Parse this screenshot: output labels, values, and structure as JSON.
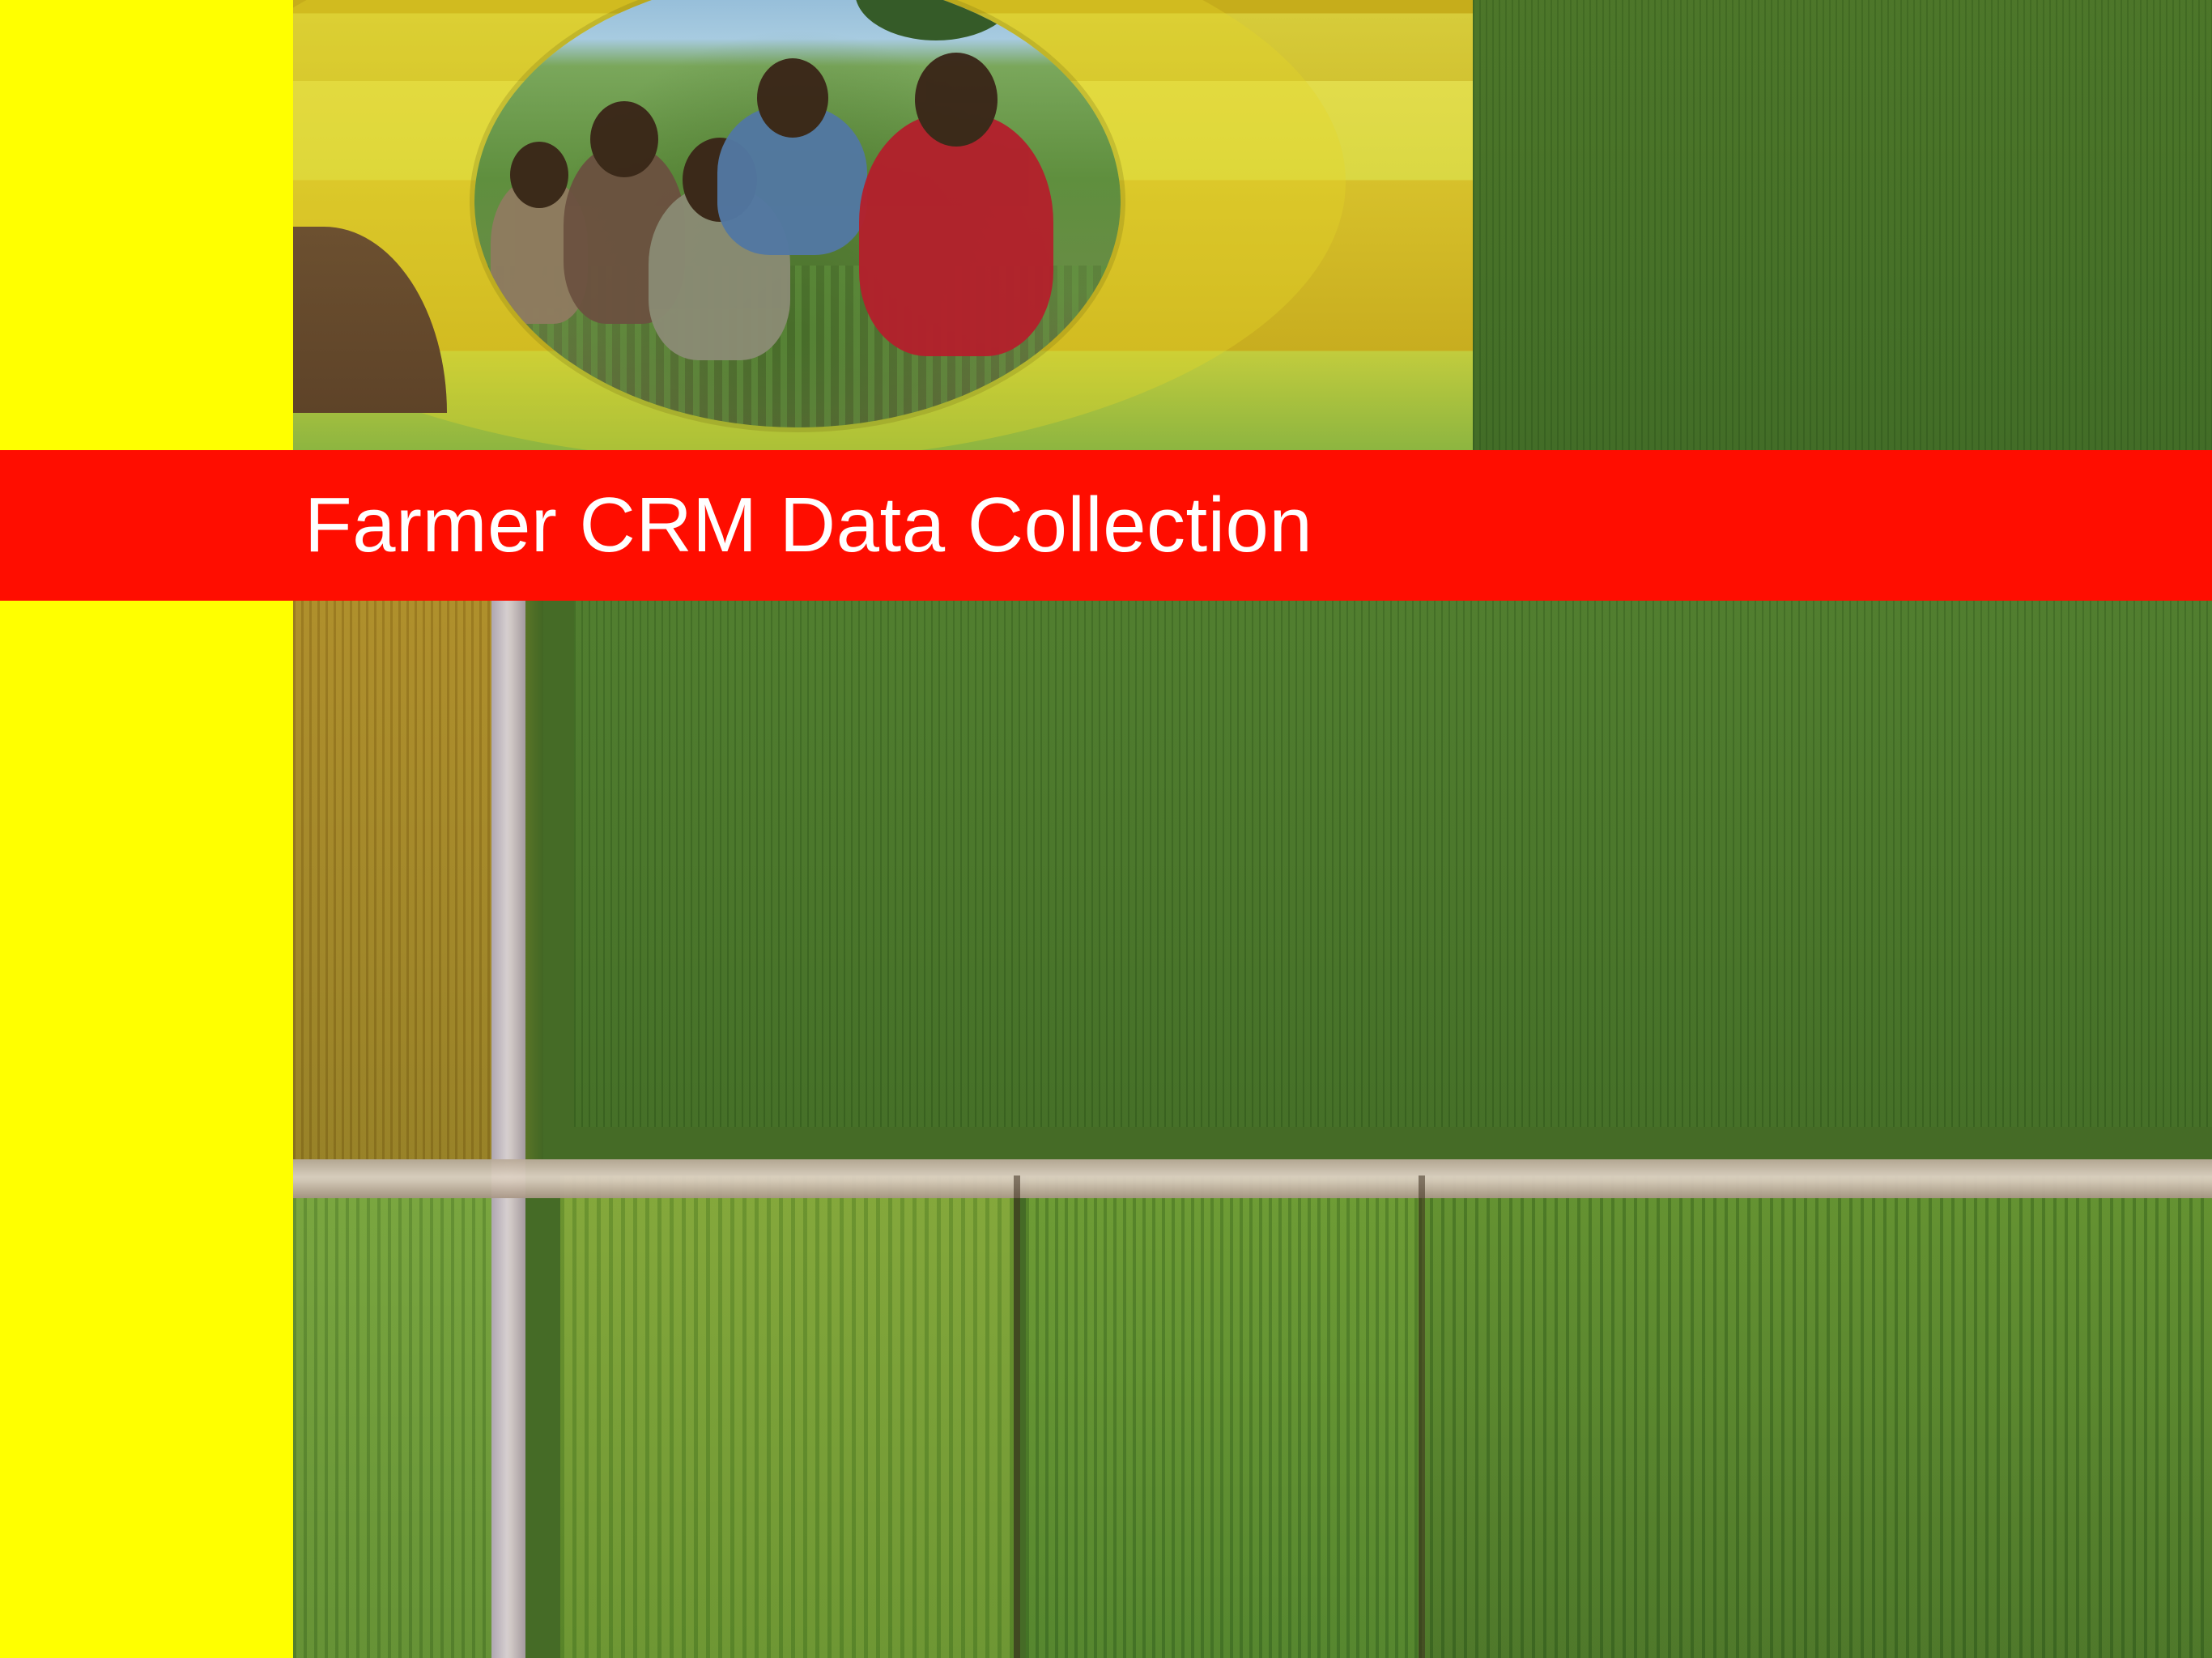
{
  "title": {
    "text": "Farmer CRM Data Collection"
  },
  "colors": {
    "left_strip": "#ffff00",
    "banner": "#ff0d00",
    "banner_text": "#ffffff"
  },
  "images": {
    "hero_photo": "children-in-field",
    "background_photo": "aerial-crop-fields"
  }
}
